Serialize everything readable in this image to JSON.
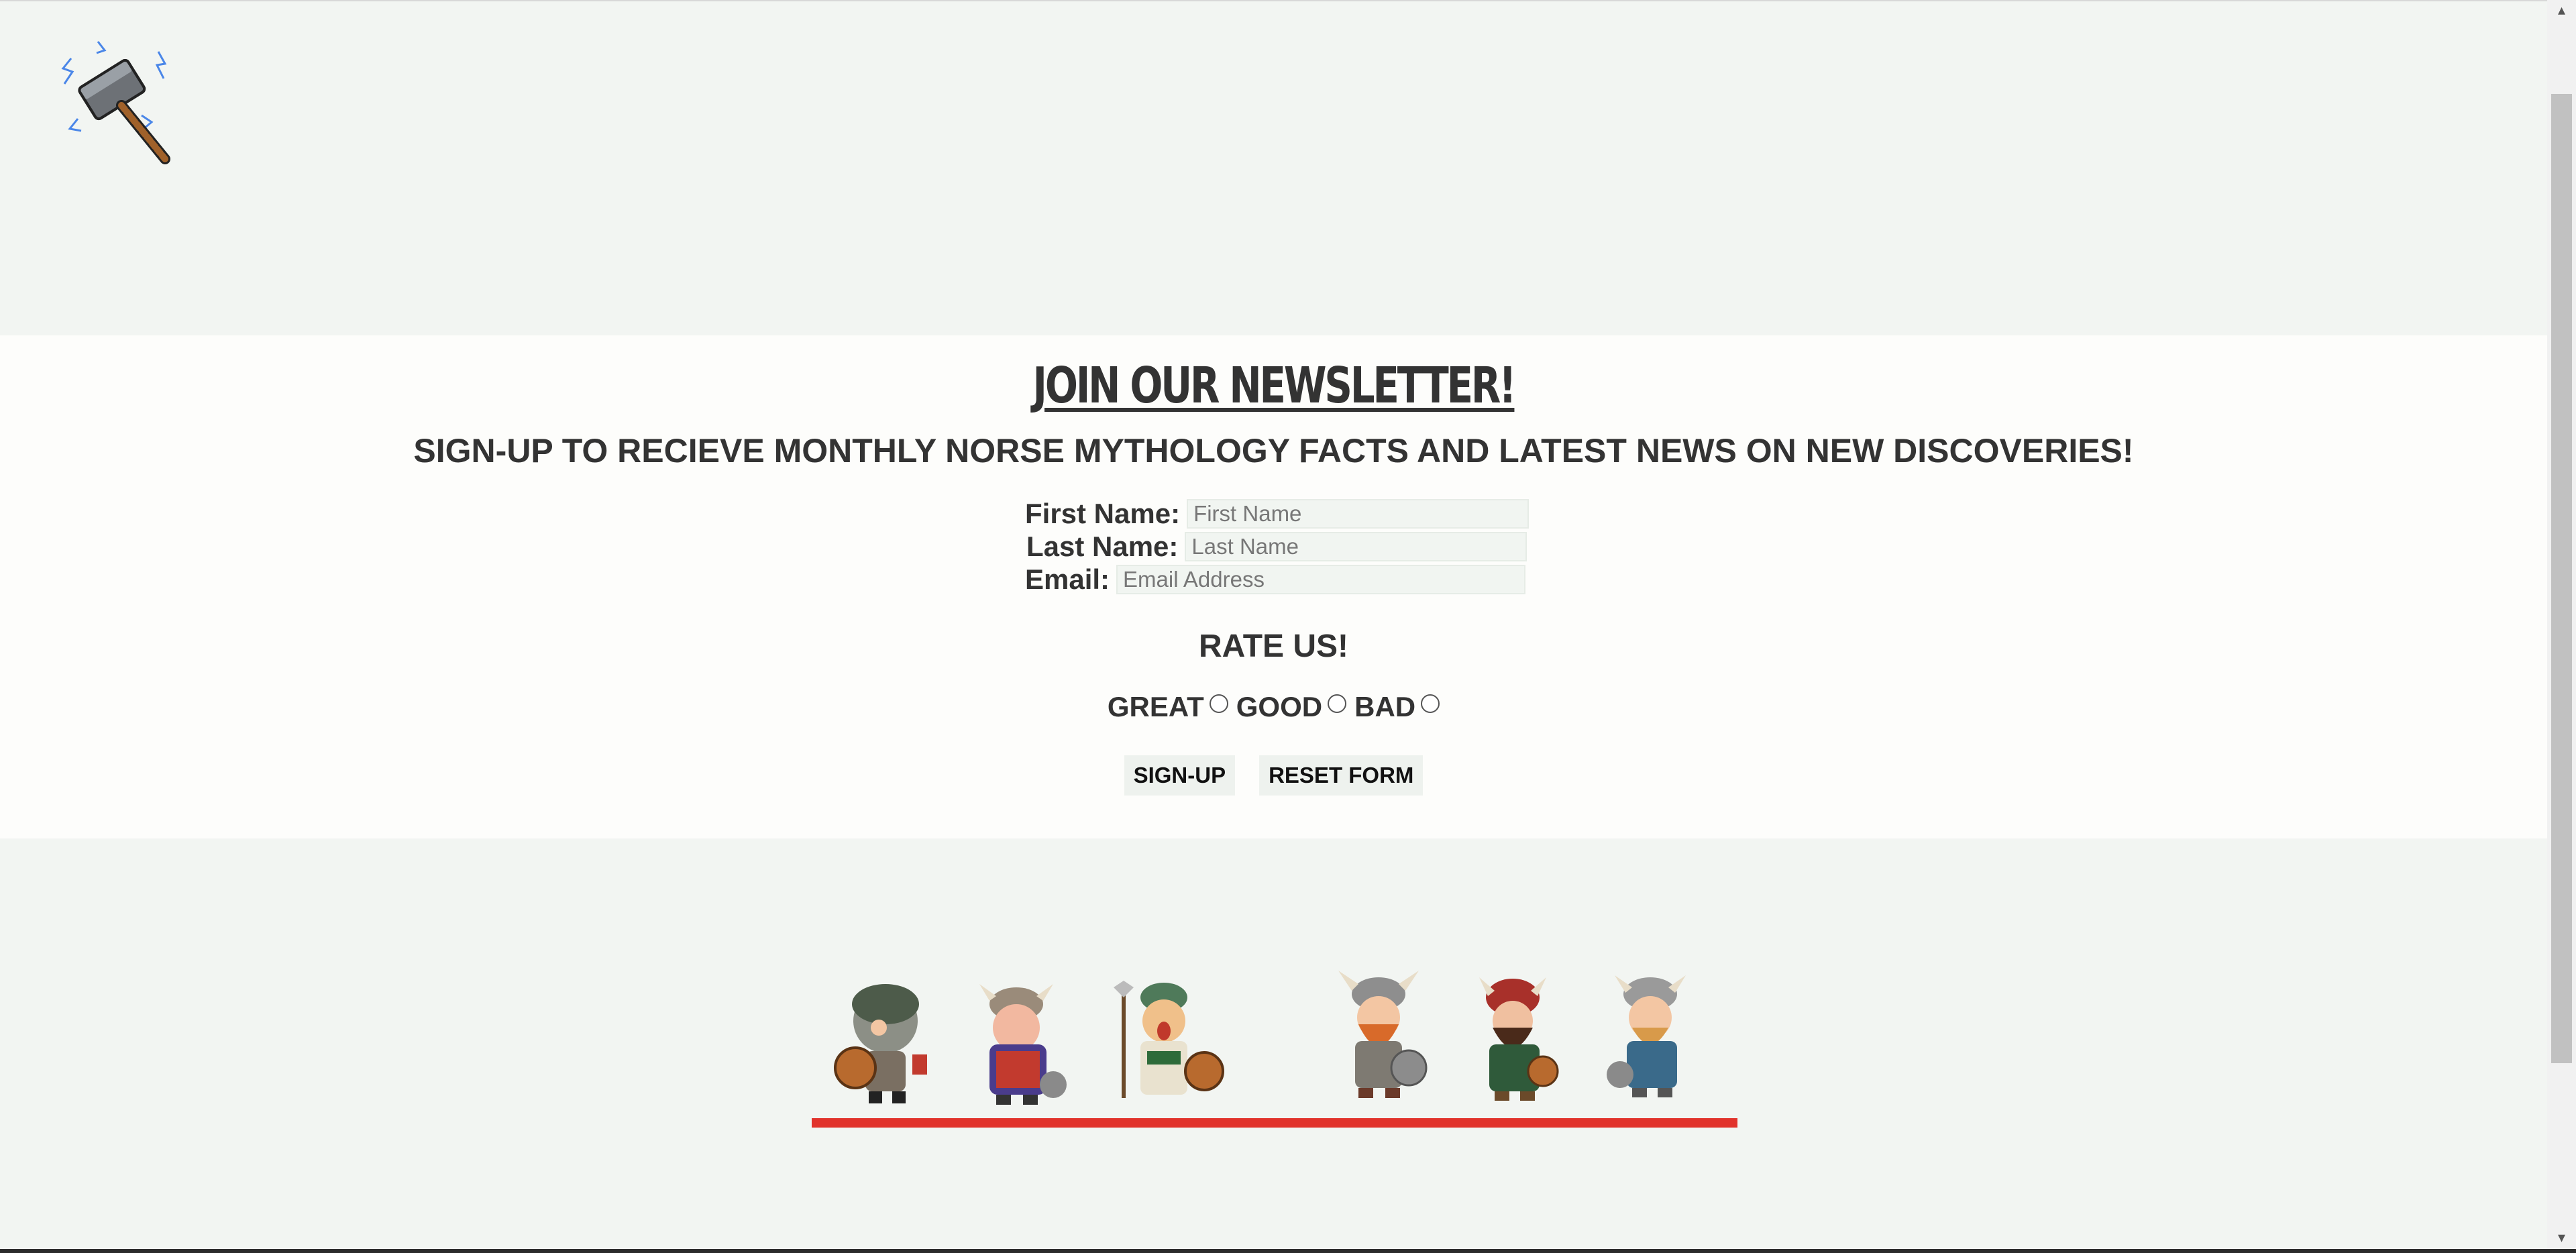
{
  "logo": {
    "icon": "thor-hammer-icon"
  },
  "newsletter": {
    "title": "JOIN OUR NEWSLETTER!",
    "subtitle": "SIGN-UP TO RECIEVE MONTHLY NORSE MYTHOLOGY FACTS AND LATEST NEWS ON NEW DISCOVERIES!",
    "fields": {
      "first_name": {
        "label": "First Name:",
        "placeholder": "First Name",
        "value": ""
      },
      "last_name": {
        "label": "Last Name:",
        "placeholder": "Last Name",
        "value": ""
      },
      "email": {
        "label": "Email:",
        "placeholder": "Email Address",
        "value": ""
      }
    },
    "rating": {
      "title": "RATE US!",
      "options": [
        "GREAT",
        "GOOD",
        "BAD"
      ]
    },
    "buttons": {
      "signup": "SIGN-UP",
      "reset": "RESET FORM"
    }
  },
  "footer": {
    "vikings": [
      "viking-1",
      "viking-2",
      "viking-3",
      "viking-4",
      "viking-5",
      "viking-6"
    ],
    "divider_color": "#e1322b"
  },
  "colors": {
    "page_bg": "#f2f5f2",
    "section_bg": "#fdfdfb",
    "text": "#333333"
  }
}
